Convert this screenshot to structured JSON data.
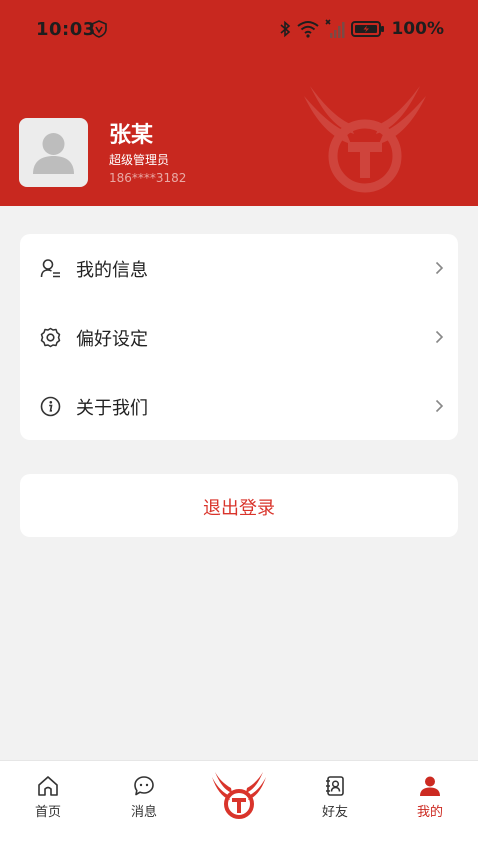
{
  "status_bar": {
    "time": "10:03",
    "battery": "100%"
  },
  "profile": {
    "name": "张某",
    "role": "超级管理员",
    "phone": "186****3182"
  },
  "menu": {
    "items": [
      {
        "label": "我的信息",
        "icon": "user-info-icon"
      },
      {
        "label": "偏好设定",
        "icon": "gear-icon"
      },
      {
        "label": "关于我们",
        "icon": "info-icon"
      }
    ]
  },
  "logout": {
    "label": "退出登录"
  },
  "tabbar": {
    "items": [
      {
        "label": "首页",
        "icon": "home-icon"
      },
      {
        "label": "消息",
        "icon": "message-icon"
      },
      {
        "label": "好友",
        "icon": "contacts-icon"
      },
      {
        "label": "我的",
        "icon": "person-icon",
        "active": true
      }
    ]
  },
  "colors": {
    "brand": "#c8281f",
    "accent_text": "#d9342b",
    "background": "#f2f2f2"
  }
}
